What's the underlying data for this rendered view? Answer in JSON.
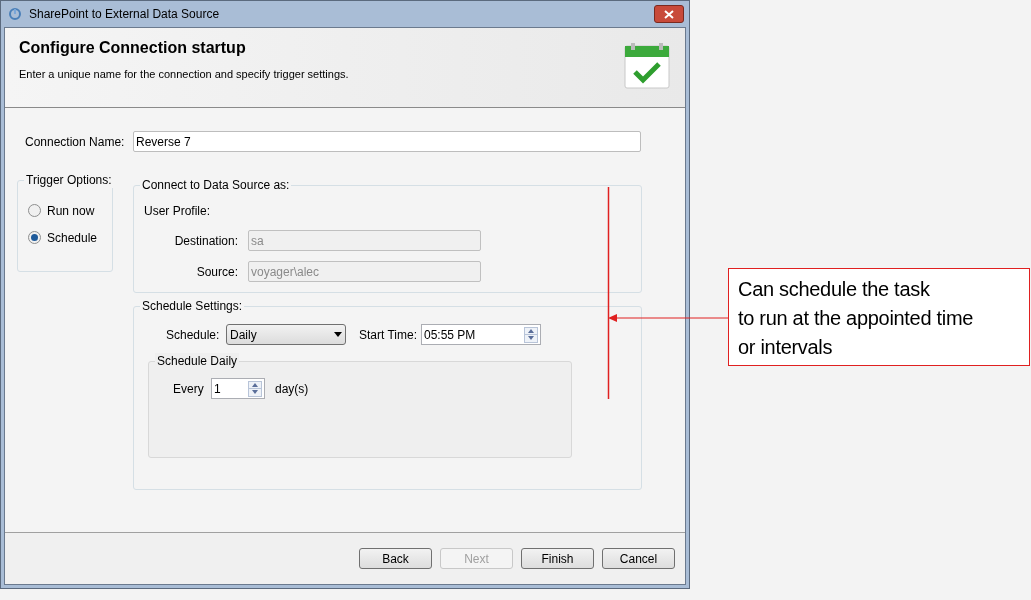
{
  "window": {
    "title": "SharePoint to External Data Source"
  },
  "header": {
    "title": "Configure Connection startup",
    "subtitle": "Enter a unique name for the connection and specify trigger settings."
  },
  "connection_name": {
    "label": "Connection Name:",
    "value": "Reverse 7"
  },
  "trigger_options": {
    "title": "Trigger Options:",
    "options": [
      {
        "label": "Run now",
        "selected": false
      },
      {
        "label": "Schedule",
        "selected": true
      }
    ]
  },
  "connect_as": {
    "title": "Connect to Data Source as:",
    "user_profile": "User Profile:",
    "fields": [
      {
        "label": "Destination:",
        "value": "sa",
        "disabled": true
      },
      {
        "label": "Source:",
        "value": "voyager\\alec",
        "disabled": true
      }
    ]
  },
  "schedule_settings": {
    "title": "Schedule Settings:",
    "schedule": {
      "label": "Schedule:",
      "value": "Daily"
    },
    "start_time": {
      "label": "Start Time:",
      "value": "05:55 PM"
    },
    "daily": {
      "title": "Schedule Daily",
      "every_label": "Every",
      "every_value": "1",
      "unit": "day(s)"
    }
  },
  "buttons": [
    {
      "label": "Back",
      "disabled": false
    },
    {
      "label": "Next",
      "disabled": true
    },
    {
      "label": "Finish",
      "disabled": false
    },
    {
      "label": "Cancel",
      "disabled": false
    }
  ],
  "annotation": {
    "lines": [
      "Can schedule the task",
      "to run at the appointed time",
      "or intervals"
    ]
  }
}
